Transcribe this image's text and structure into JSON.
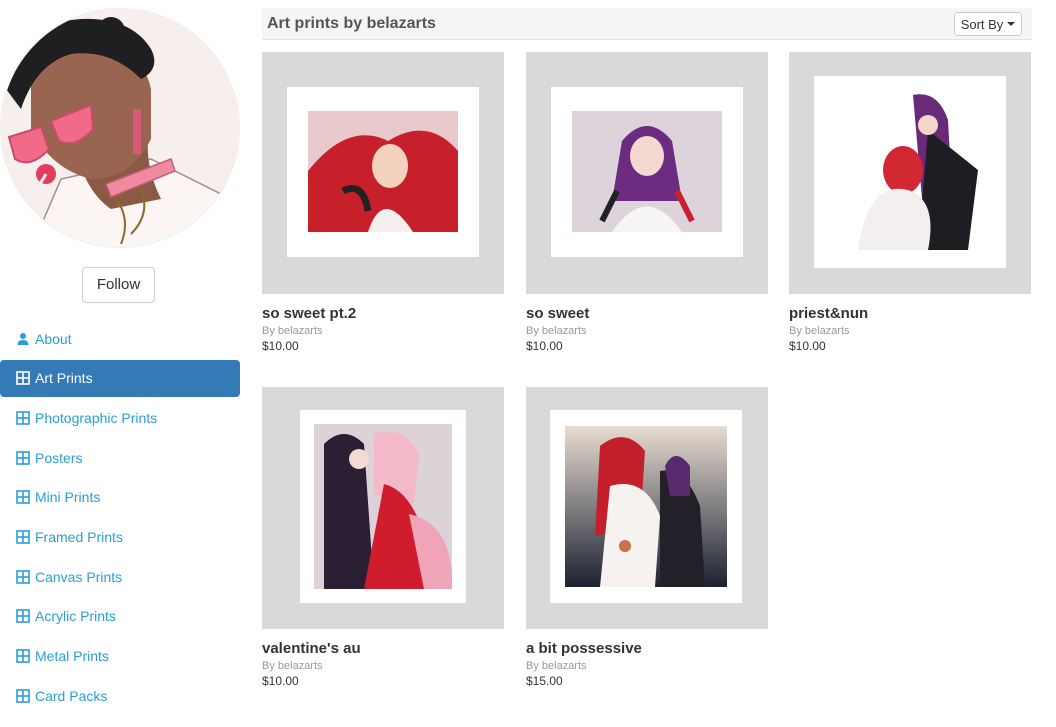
{
  "page": {
    "title": "Art prints by belazarts",
    "sort_label": "Sort By"
  },
  "profile": {
    "follow_label": "Follow"
  },
  "nav": [
    {
      "label": "About",
      "icon": "user-icon",
      "active": false
    },
    {
      "label": "Art Prints",
      "icon": "grid-icon",
      "active": true
    },
    {
      "label": "Photographic Prints",
      "icon": "grid-icon",
      "active": false
    },
    {
      "label": "Posters",
      "icon": "grid-icon",
      "active": false
    },
    {
      "label": "Mini Prints",
      "icon": "grid-icon",
      "active": false
    },
    {
      "label": "Framed Prints",
      "icon": "grid-icon",
      "active": false
    },
    {
      "label": "Canvas Prints",
      "icon": "grid-icon",
      "active": false
    },
    {
      "label": "Acrylic Prints",
      "icon": "grid-icon",
      "active": false
    },
    {
      "label": "Metal Prints",
      "icon": "grid-icon",
      "active": false
    },
    {
      "label": "Card Packs",
      "icon": "grid-icon",
      "active": false
    }
  ],
  "products": [
    {
      "title": "so sweet pt.2",
      "by": "By belazarts",
      "price": "$10.00"
    },
    {
      "title": "so sweet",
      "by": "By belazarts",
      "price": "$10.00"
    },
    {
      "title": "priest&nun",
      "by": "By belazarts",
      "price": "$10.00"
    },
    {
      "title": "valentine's au",
      "by": "By belazarts",
      "price": "$10.00"
    },
    {
      "title": "a bit possessive",
      "by": "By belazarts",
      "price": "$15.00"
    }
  ],
  "colors": {
    "accent": "#2a9fd6",
    "active_bg": "#337ab7",
    "thumb_bg": "#d9d9d9"
  }
}
